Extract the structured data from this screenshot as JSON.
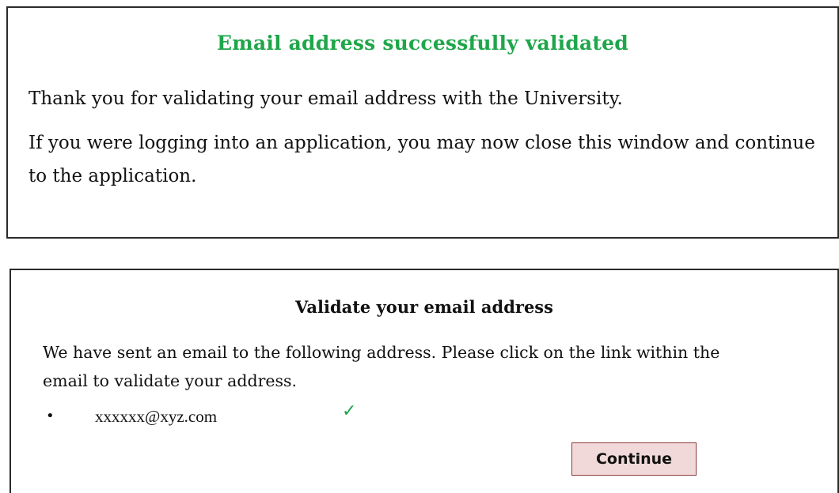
{
  "success_panel": {
    "title": "Email address successfully validated",
    "paragraph1": "Thank you for validating your email address with the University.",
    "paragraph2": "If you were logging into an application, you may now close this window and continue to the application."
  },
  "validate_panel": {
    "title": "Validate your email address",
    "paragraph": "We have sent an email to the following address. Please click on the link within the email to validate your address.",
    "bullet": "•",
    "email": "xxxxxx@xyz.com",
    "check_icon": "✓",
    "continue_label": "Continue"
  },
  "colors": {
    "success_green": "#1fa64a",
    "button_fill": "#f2d9d9",
    "button_border": "#8b3a3a",
    "panel_border": "#2b2b2b"
  },
  "icons": {
    "email_status": "checkmark-icon"
  }
}
